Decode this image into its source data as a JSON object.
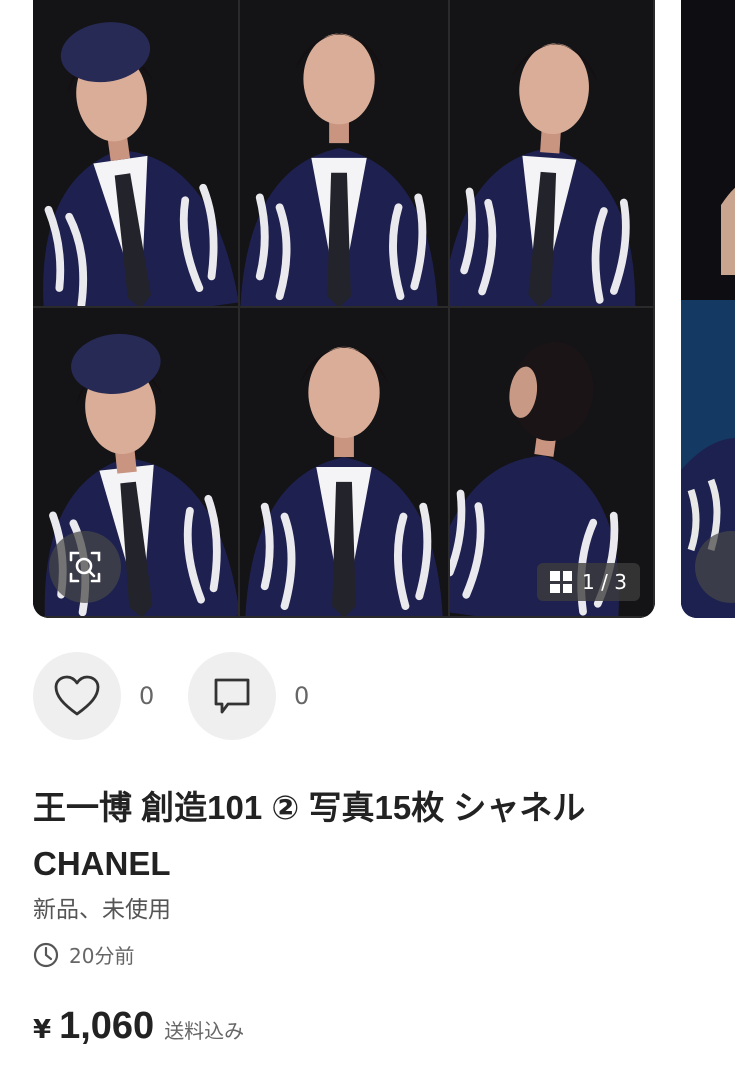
{
  "gallery": {
    "counter": "1 / 3",
    "icons": {
      "zoom": "zoom-scan-icon",
      "grid": "grid-icon"
    },
    "colors": {
      "photo_bg": "#1b1a1d",
      "cardigan": "#1e2150"
    }
  },
  "actions": {
    "like_count": "0",
    "comment_count": "0",
    "icons": {
      "like": "heart-icon",
      "comment": "comment-icon"
    }
  },
  "item": {
    "title": "王一博 創造101 ② 写真15枚 シャネル CHANEL",
    "condition": "新品、未使用",
    "posted_time": "20分前",
    "currency": "¥",
    "price": "1,060",
    "shipping_note": "送料込み"
  }
}
